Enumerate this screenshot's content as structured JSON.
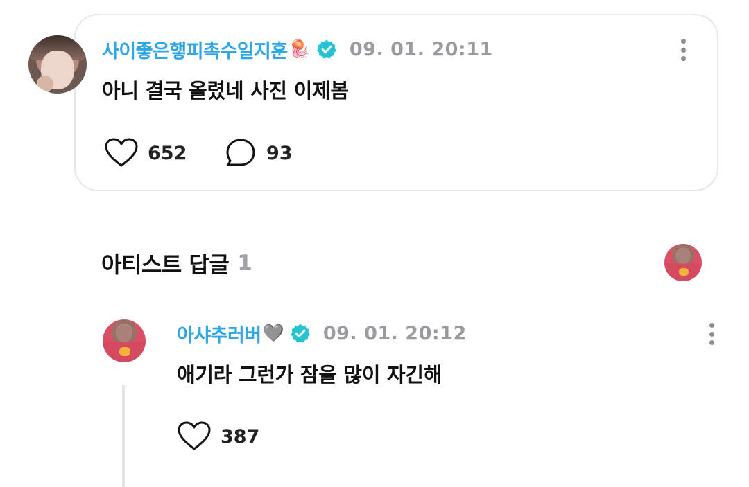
{
  "post": {
    "author": "사이좋은햏피촉수일지훈",
    "author_emoji": "🪼",
    "timestamp": "09. 01. 20:11",
    "body": "아니 결국 올렸네 사진 이제봄",
    "like_count": "652",
    "comment_count": "93"
  },
  "artist_replies": {
    "title": "아티스트 답글",
    "count": "1"
  },
  "reply": {
    "author": "아샤추러버",
    "author_emoji": "🩶",
    "timestamp": "09. 01. 20:12",
    "body": "애기라 그런가 잠을 많이 자긴해",
    "like_count": "387"
  },
  "colors": {
    "author_blue": "#2fa6e8",
    "verified_teal": "#27c3d4",
    "timestamp_gray": "#9b9b9f",
    "border": "#e7e7ea"
  },
  "icons": {
    "verified": "verified-badge-icon",
    "like": "heart-outline-icon",
    "comment": "speech-bubble-icon",
    "more": "vertical-ellipsis-icon"
  }
}
